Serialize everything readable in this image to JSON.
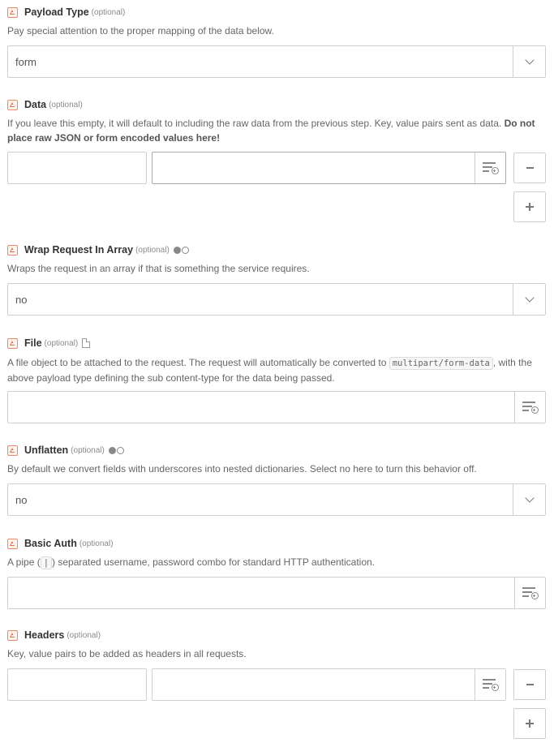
{
  "payload_type": {
    "label": "Payload Type",
    "optional": "(optional)",
    "help": "Pay special attention to the proper mapping of the data below.",
    "value": "form"
  },
  "data": {
    "label": "Data",
    "optional": "(optional)",
    "help_plain": "If you leave this empty, it will default to including the raw data from the previous step. Key, value pairs sent as data.",
    "help_bold": "Do not place raw JSON or form encoded values here!",
    "key_value": "",
    "val_value": ""
  },
  "wrap_request": {
    "label": "Wrap Request In Array",
    "optional": "(optional)",
    "help": "Wraps the request in an array if that is something the service requires.",
    "value": "no"
  },
  "file": {
    "label": "File",
    "optional": "(optional)",
    "help_before": "A file object to be attached to the request. The request will automatically be converted to",
    "help_code": "multipart/form-data",
    "help_after": ", with the above payload type defining the sub content-type for the data being passed.",
    "value": ""
  },
  "unflatten": {
    "label": "Unflatten",
    "optional": "(optional)",
    "help": "By default we convert fields with underscores into nested dictionaries. Select no here to turn this behavior off.",
    "value": "no"
  },
  "basic_auth": {
    "label": "Basic Auth",
    "optional": "(optional)",
    "help_before": "A pipe (",
    "help_code": "|",
    "help_after": ") separated username, password combo for standard HTTP authentication.",
    "value": ""
  },
  "headers": {
    "label": "Headers",
    "optional": "(optional)",
    "help": "Key, value pairs to be added as headers in all requests.",
    "key_value": "",
    "val_value": ""
  },
  "icons": {
    "field": "field-type-icon",
    "toggle": "boolean-toggle-icon",
    "file": "file-icon",
    "insert": "insert-data-icon",
    "dropdown": "chevron-down-icon",
    "remove": "minus-icon",
    "add": "plus-icon"
  },
  "colors": {
    "field_icon_accent": "#ef6f44",
    "border": "#cfcfcf",
    "label": "#333333",
    "help": "#666666"
  }
}
